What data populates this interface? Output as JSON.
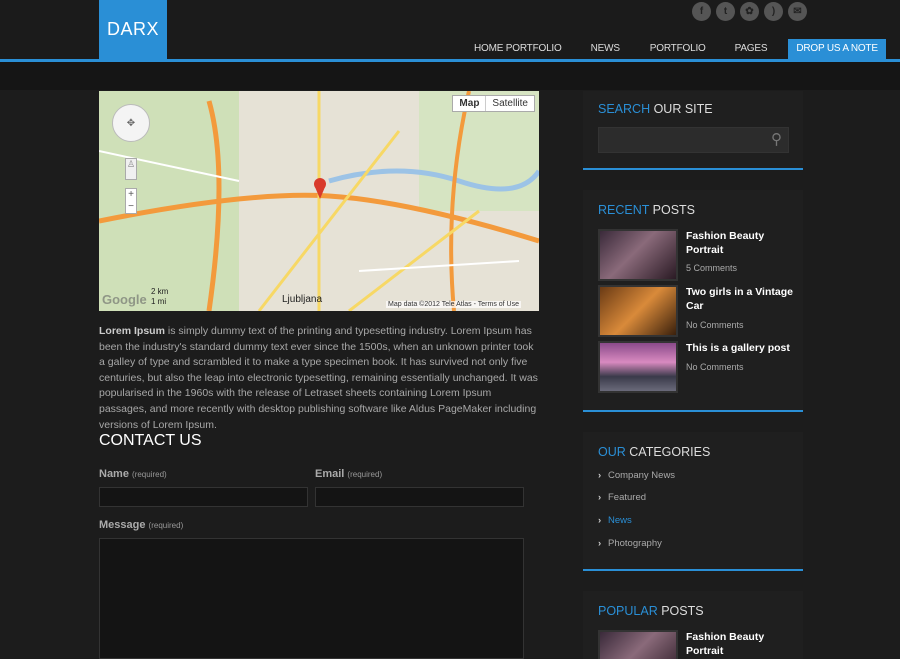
{
  "logo": "DARX",
  "socials": [
    {
      "icon": "facebook-icon",
      "glyph": "f"
    },
    {
      "icon": "twitter-icon",
      "glyph": "t"
    },
    {
      "icon": "flickr-icon",
      "glyph": "✿"
    },
    {
      "icon": "rss-icon",
      "glyph": ")"
    },
    {
      "icon": "mail-icon",
      "glyph": "✉"
    }
  ],
  "nav": [
    "HOME PORTFOLIO",
    "NEWS",
    "PORTFOLIO",
    "PAGES",
    "DROP US A NOTE"
  ],
  "map": {
    "btn_map": "Map",
    "btn_satellite": "Satellite",
    "credit": "Map data ©2012 Tele Atlas - Terms of Use",
    "google": "Google",
    "scale_km": "2 km",
    "scale_mi": "1 mi",
    "city": "Ljubljana",
    "zoom_in": "+",
    "zoom_out": "−"
  },
  "intro": {
    "lead": "Lorem Ipsum",
    "text": " is simply dummy text of the printing and typesetting industry. Lorem Ipsum has been the industry's standard dummy text ever since the 1500s, when an unknown printer took a galley of type and scrambled it to make a type specimen book. It has survived not only five centuries, but also the leap into electronic typesetting, remaining essentially unchanged. It was popularised in the 1960s with the release of Letraset sheets containing Lorem Ipsum passages, and more recently with desktop publishing software like Aldus PageMaker including versions of Lorem Ipsum."
  },
  "contact": {
    "title": "CONTACT US",
    "name_label": "Name",
    "email_label": "Email",
    "message_label": "Message",
    "required": "(required)"
  },
  "sidebar": {
    "search": {
      "hl": "SEARCH",
      "rest": " OUR SITE"
    },
    "recent": {
      "hl": "RECENT",
      "rest": " POSTS",
      "posts": [
        {
          "title": "Fashion Beauty Portrait",
          "meta": "5 Comments"
        },
        {
          "title": "Two girls in a Vintage Car",
          "meta": "No Comments"
        },
        {
          "title": "This is a gallery post",
          "meta": "No Comments"
        }
      ]
    },
    "categories": {
      "hl": "OUR",
      "rest": " CATEGORIES",
      "items": [
        "Company News",
        "Featured",
        "News",
        "Photography"
      ]
    },
    "popular": {
      "hl": "POPULAR",
      "rest": " POSTS",
      "posts": [
        {
          "title": "Fashion Beauty Portrait"
        }
      ]
    }
  },
  "colors": {
    "accent": "#2a8fd6",
    "background": "#1c1c1c"
  }
}
